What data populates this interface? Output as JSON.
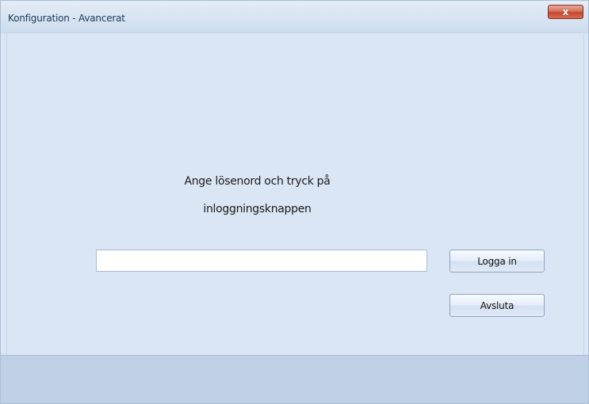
{
  "window": {
    "title": "Konfiguration - Avancerat",
    "close_label": "x"
  },
  "prompt": {
    "line1": "Ange lösenord och tryck på",
    "line2": "inloggningsknappen"
  },
  "password": {
    "value": ""
  },
  "buttons": {
    "login_label": "Logga in",
    "quit_label": "Avsluta"
  }
}
